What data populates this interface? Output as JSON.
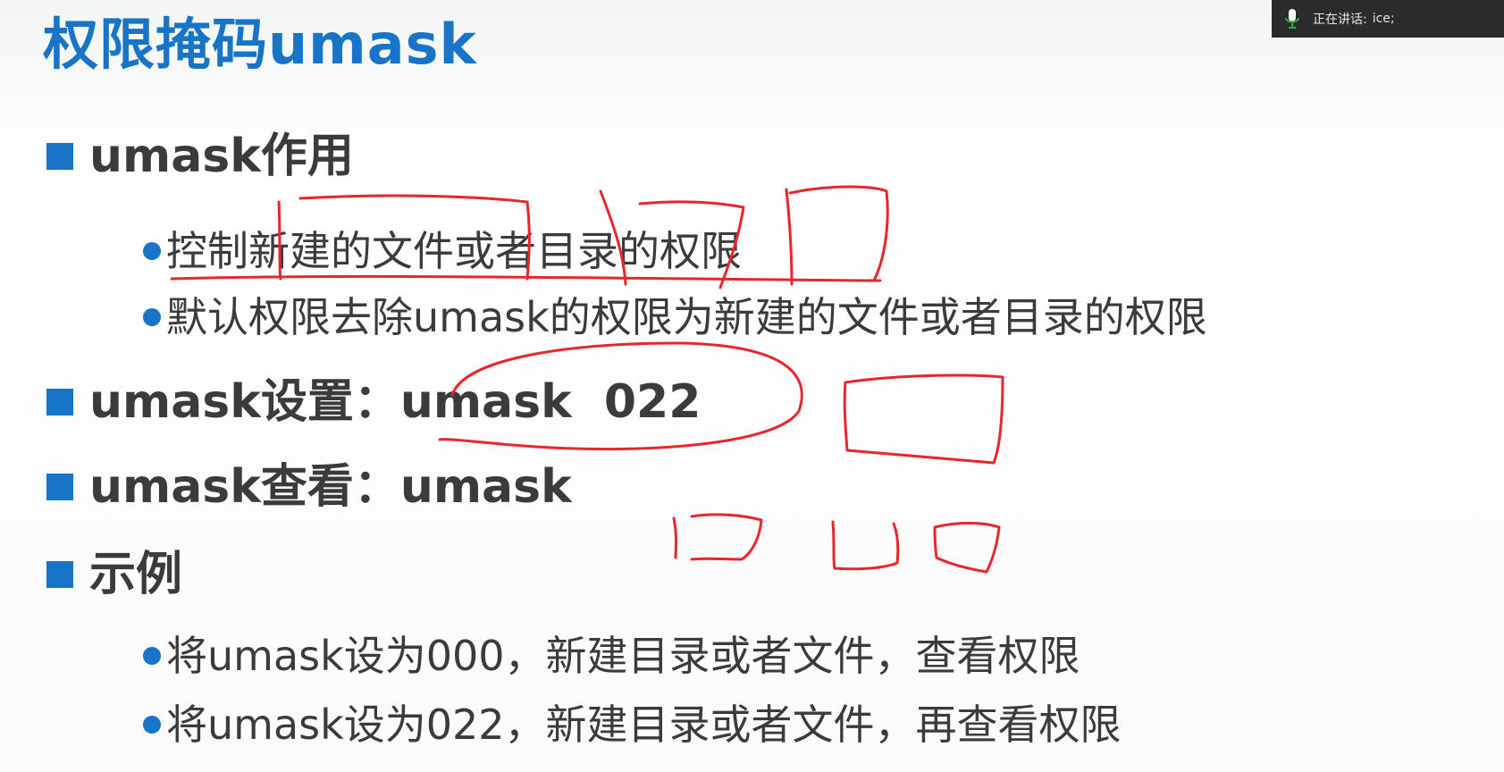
{
  "slide": {
    "title": "权限掩码umask",
    "sections": [
      {
        "heading": "umask作用",
        "items": [
          "控制新建的文件或者目录的权限",
          "默认权限去除umask的权限为新建的文件或者目录的权限"
        ]
      },
      {
        "heading": "umask设置：umask  022",
        "items": []
      },
      {
        "heading": "umask查看：umask",
        "items": []
      },
      {
        "heading": "示例",
        "items": [
          "将umask设为000，新建目录或者文件，查看权限",
          "将umask设为022，新建目录或者文件，再查看权限"
        ]
      }
    ]
  },
  "speaking_indicator": {
    "label": "正在讲话:",
    "speaker": "ice;"
  },
  "colors": {
    "accent": "#1874c6",
    "annotation": "#e8262b",
    "text": "#3b3b3b"
  }
}
